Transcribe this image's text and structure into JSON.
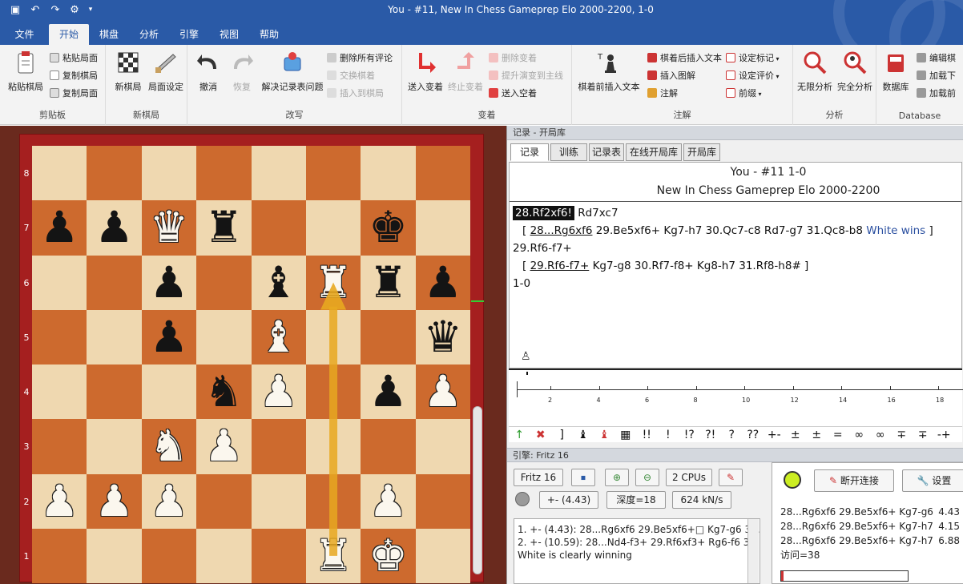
{
  "window": {
    "title": "You - #11, New In Chess Gameprep Elo 2000-2200, 1-0"
  },
  "quickaccess": [
    "save-icon",
    "undo-icon",
    "redo-icon",
    "gear-icon",
    "dropdown-icon"
  ],
  "tabs": [
    {
      "label": "文件"
    },
    {
      "label": "开始"
    },
    {
      "label": "棋盘"
    },
    {
      "label": "分析"
    },
    {
      "label": "引擎"
    },
    {
      "label": "视图"
    },
    {
      "label": "帮助"
    }
  ],
  "ribbon": {
    "clipboard": {
      "label": "剪贴板",
      "paste_game": "粘贴棋局",
      "paste_position": "粘贴局面",
      "copy_game": "复制棋局",
      "copy_position": "复制局面"
    },
    "newgame": {
      "label": "新棋局",
      "new_game": "新棋局",
      "setup": "局面设定"
    },
    "edit": {
      "label": "改写",
      "undo": "撤消",
      "redo": "恢复",
      "solve": "解决记录表问题",
      "delete_comments": "删除所有评论",
      "swap": "交换棋着",
      "insert": "插入到棋局"
    },
    "variation": {
      "label": "变着",
      "enter": "送入变着",
      "end": "终止变着",
      "delete": "删除变着",
      "promote": "提升演变到主线",
      "enter_null": "送入空着"
    },
    "annotate": {
      "label": "注解",
      "before_text": "棋着前插入文本",
      "after_text": "棋着后插入文本",
      "insert_diagram": "插入图解",
      "annotate": "注解",
      "set_mark": "设定标记",
      "set_eval": "设定评价",
      "prefix": "前缀"
    },
    "analysis": {
      "label": "分析",
      "infinite": "无限分析",
      "full": "完全分析"
    },
    "database": {
      "label": "Database",
      "db": "数据库",
      "edit": "编辑棋",
      "load_next": "加载下",
      "load_prev": "加载前"
    }
  },
  "board": {
    "ranks": [
      "8",
      "7",
      "6",
      "5",
      "4",
      "3",
      "2",
      "1"
    ],
    "pieces": [
      {
        "sq": "a7",
        "glyph": "♟",
        "side": "b"
      },
      {
        "sq": "b7",
        "glyph": "♟",
        "side": "b"
      },
      {
        "sq": "c7",
        "glyph": "♛",
        "side": "w"
      },
      {
        "sq": "d7",
        "glyph": "♜",
        "side": "b"
      },
      {
        "sq": "g7",
        "glyph": "♚",
        "side": "b"
      },
      {
        "sq": "c6",
        "glyph": "♟",
        "side": "b"
      },
      {
        "sq": "e6",
        "glyph": "♝",
        "side": "b"
      },
      {
        "sq": "f6",
        "glyph": "♜",
        "side": "w"
      },
      {
        "sq": "g6",
        "glyph": "♜",
        "side": "b"
      },
      {
        "sq": "h6",
        "glyph": "♟",
        "side": "b"
      },
      {
        "sq": "c5",
        "glyph": "♟",
        "side": "b"
      },
      {
        "sq": "e5",
        "glyph": "♝",
        "side": "w"
      },
      {
        "sq": "h5",
        "glyph": "♛",
        "side": "b"
      },
      {
        "sq": "d4",
        "glyph": "♞",
        "side": "b"
      },
      {
        "sq": "e4",
        "glyph": "♟",
        "side": "w"
      },
      {
        "sq": "g4",
        "glyph": "♟",
        "side": "b"
      },
      {
        "sq": "h4",
        "glyph": "♟",
        "side": "w"
      },
      {
        "sq": "c3",
        "glyph": "♞",
        "side": "w"
      },
      {
        "sq": "d3",
        "glyph": "♟",
        "side": "w"
      },
      {
        "sq": "a2",
        "glyph": "♟",
        "side": "w"
      },
      {
        "sq": "b2",
        "glyph": "♟",
        "side": "w"
      },
      {
        "sq": "c2",
        "glyph": "♟",
        "side": "w"
      },
      {
        "sq": "g2",
        "glyph": "♟",
        "side": "w"
      },
      {
        "sq": "f1",
        "glyph": "♜",
        "side": "w"
      },
      {
        "sq": "g1",
        "glyph": "♚",
        "side": "w"
      }
    ],
    "arrow": {
      "from": "f1",
      "to": "f6",
      "color": "#e8a820"
    }
  },
  "notation": {
    "pane_title": "记录 - 开局库",
    "tabs": [
      "记录",
      "训练",
      "记录表",
      "在线开局库",
      "开局库"
    ],
    "header1": "You - #11  1-0",
    "header2": "New In Chess Gameprep Elo 2000-2200",
    "line1_move": "28.Rf2xf6!",
    "line1_rest": " Rd7xc7",
    "line2_open": "[ ",
    "line2_ul": "28...Rg6xf6",
    "line2_rest": " 29.Be5xf6+  Kg7-h7  30.Qc7-c8  Rd7-g7  31.Qc8-b8 ",
    "line2_blue": "White wins",
    "line2_close": " ]",
    "line3": "29.Rf6-f7+",
    "line4_open": "[ ",
    "line4_ul": "29.Rf6-f7+",
    "line4_rest": "  Kg7-g8  30.Rf7-f8+  Kg8-h7  31.Rf8-h8# ]",
    "line5": "1-0"
  },
  "evalgraph": {
    "ticks": [
      "2",
      "4",
      "6",
      "8",
      "10",
      "12",
      "14",
      "16",
      "18"
    ]
  },
  "symbols": [
    "↑",
    "✖",
    "]",
    "♝",
    "♝",
    "▦",
    "!!",
    "!",
    "!?",
    "?!",
    "?",
    "??",
    "+-",
    "±",
    "±",
    "=",
    "∞",
    "∞",
    "∓",
    "∓",
    "-+"
  ],
  "engine": {
    "pane_title": "引擎: Fritz 16",
    "name": "Fritz 16",
    "cpus": "2 CPUs",
    "eval": "+- (4.43)",
    "depth": "深度=18",
    "speed": "624 kN/s",
    "line1": "1. +- (4.43): 28...Rg6xf6 29.Be5xf6+□ Kg7-g6 30.Q",
    "line2": "2. +- (10.59): 28...Nd4-f3+ 29.Rf6xf3+ Rg6-f6 30.Rf",
    "line3": "White is clearly winning"
  },
  "kibitzer": {
    "disconnect": "断开连接",
    "settings": "设置",
    "lines": [
      {
        "moves": "28...Rg6xf6 29.Be5xf6+ Kg7-g6",
        "score": "4.43"
      },
      {
        "moves": "28...Rg6xf6 29.Be5xf6+ Kg7-h7",
        "score": "4.15"
      },
      {
        "moves": "28...Rg6xf6 29.Be5xf6+ Kg7-h7",
        "score": "6.88"
      }
    ],
    "visits": "访问=38"
  }
}
